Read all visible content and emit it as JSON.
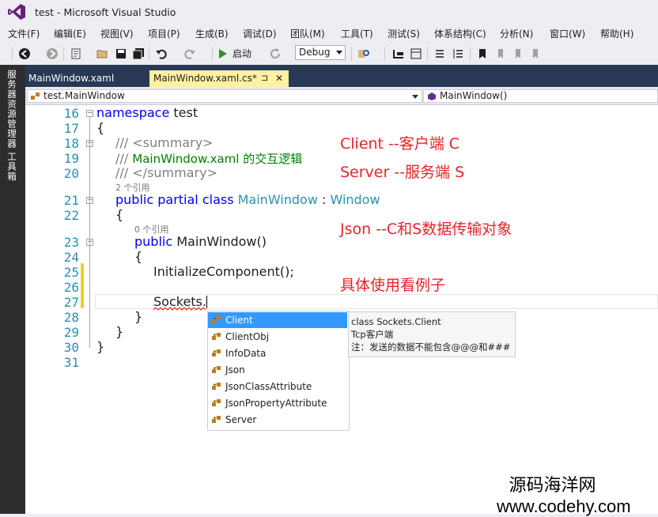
{
  "window": {
    "title": "test - Microsoft Visual Studio"
  },
  "menu": [
    "文件(F)",
    "编辑(E)",
    "视图(V)",
    "项目(P)",
    "生成(B)",
    "调试(D)",
    "团队(M)",
    "工具(T)",
    "测试(S)",
    "体系结构(C)",
    "分析(N)",
    "窗口(W)",
    "帮助(H)"
  ],
  "toolbar": {
    "start_label": "启动",
    "config": "Debug"
  },
  "left_dock": {
    "tabs": [
      "服务器资源管理器",
      "工具箱"
    ]
  },
  "tabs": {
    "inactive": "MainWindow.xaml",
    "active": "MainWindow.xaml.cs*",
    "pin": "⊐",
    "close": "✕"
  },
  "nav": {
    "type": "test.MainWindow",
    "member": "MainWindow()"
  },
  "editor": {
    "line_numbers": [
      "16",
      "17",
      "18",
      "19",
      "20",
      "21",
      "22",
      "23",
      "24",
      "25",
      "26",
      "27",
      "28",
      "29",
      "30",
      "31"
    ],
    "refs": [
      "2 个引用",
      "0 个引用"
    ],
    "code": {
      "l16_kw": "namespace",
      "l16_name": " test",
      "l17": "{",
      "l18_a": "/// ",
      "l18_b": "<summary>",
      "l19_a": "/// ",
      "l19_b": "MainWindow.xaml 的交互逻辑",
      "l20_a": "/// ",
      "l20_b": "</summary>",
      "l21_kw": "public partial class ",
      "l21_type": "MainWindow",
      "l21_sep": " : ",
      "l21_base": "Window",
      "l22": "{",
      "l23_kw": "public ",
      "l23_rest": "MainWindow()",
      "l24": "{",
      "l25": "InitializeComponent();",
      "l27": "Sockets.",
      "l28": "}",
      "l29": "}",
      "l30": "}"
    }
  },
  "annotations": {
    "client": "Client --客户端 C",
    "server": "Server --服务端 S",
    "json": "Json   --C和S数据传输对象",
    "example": "具体使用看例子"
  },
  "completion": {
    "items": [
      "Client",
      "ClientObj",
      "InfoData",
      "Json",
      "JsonClassAttribute",
      "JsonPropertyAttribute",
      "Server"
    ],
    "selected_index": 0
  },
  "tooltip": {
    "line1": "class Sockets.Client",
    "line2": "Tcp客户端",
    "line3": "注：发送的数据不能包含@@@和###"
  },
  "watermark": {
    "line1": "源码海洋网",
    "line2": "www.codehy.com"
  },
  "colors": {
    "tab_strip": "#293955",
    "active_tab": "#fff1a3",
    "selection": "#3399ff",
    "annotation": "#e8242a",
    "keyword": "#0000ff",
    "type": "#2b91af",
    "comment": "#008000"
  }
}
